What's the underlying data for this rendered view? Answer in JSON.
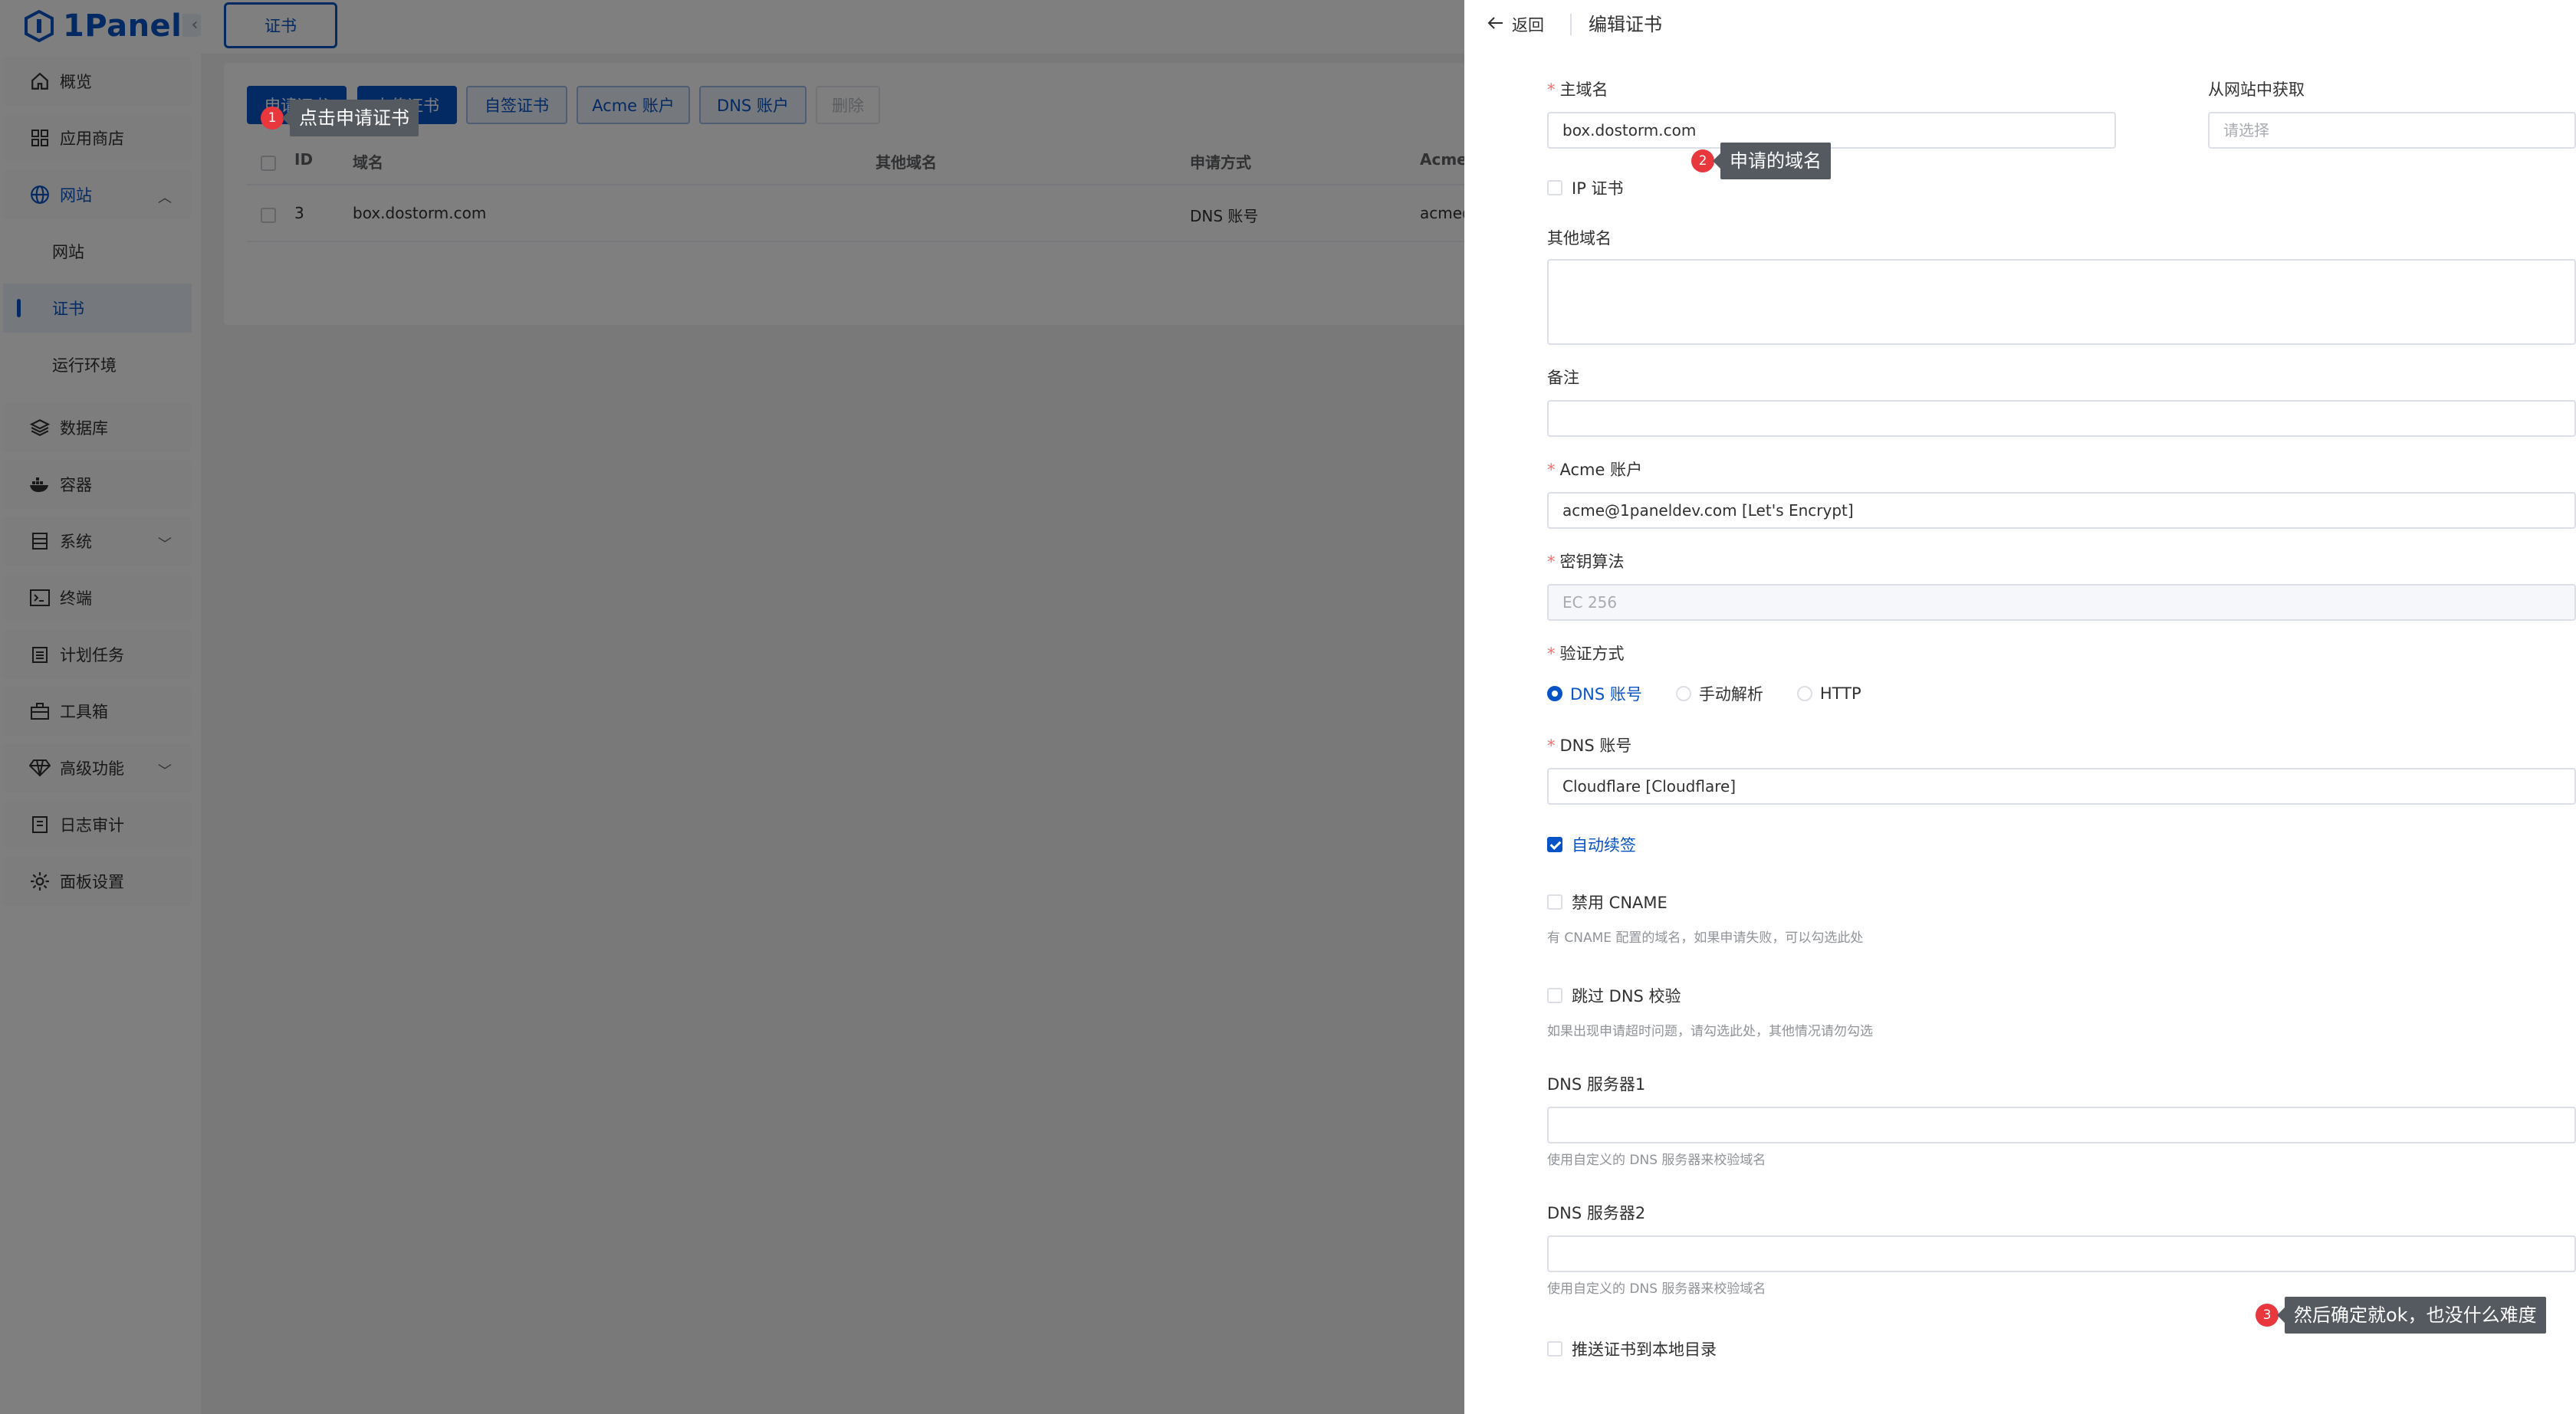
{
  "app": {
    "logo_text": "1Panel",
    "brand_color": "#0854c7"
  },
  "sidebar": {
    "items": [
      {
        "label": "概览",
        "icon": "home-icon"
      },
      {
        "label": "应用商店",
        "icon": "grid-icon"
      },
      {
        "label": "网站",
        "icon": "globe-icon",
        "expanded": true
      },
      {
        "label": "网站",
        "sub": true
      },
      {
        "label": "证书",
        "sub": true,
        "active": true
      },
      {
        "label": "运行环境",
        "sub": true
      },
      {
        "label": "数据库",
        "icon": "layers-icon"
      },
      {
        "label": "容器",
        "icon": "docker-icon"
      },
      {
        "label": "系统",
        "icon": "server-icon",
        "has_children": true
      },
      {
        "label": "终端",
        "icon": "terminal-icon"
      },
      {
        "label": "计划任务",
        "icon": "calendar-icon"
      },
      {
        "label": "工具箱",
        "icon": "toolbox-icon"
      },
      {
        "label": "高级功能",
        "icon": "diamond-icon",
        "has_children": true
      },
      {
        "label": "日志审计",
        "icon": "log-icon"
      },
      {
        "label": "面板设置",
        "icon": "gear-icon"
      }
    ]
  },
  "top_tabs": {
    "active": "证书"
  },
  "toolbar": {
    "apply_cert": "申请证书",
    "upload_cert": "上传证书",
    "self_signed": "自签证书",
    "acme_account": "Acme 账户",
    "dns_account": "DNS 账户",
    "delete": "删除"
  },
  "table": {
    "headers": [
      "ID",
      "域名",
      "其他域名",
      "申请方式",
      "Acme"
    ],
    "rows": [
      {
        "id": "3",
        "domain": "box.dostorm.com",
        "other": "",
        "method": "DNS 账号",
        "acme": "acme@"
      }
    ]
  },
  "drawer": {
    "back": "返回",
    "title": "编辑证书",
    "primary_domain": {
      "label": "主域名",
      "value": "box.dostorm.com"
    },
    "from_website": {
      "label": "从网站中获取",
      "placeholder": "请选择"
    },
    "ip_cert": {
      "label": "IP 证书",
      "checked": false
    },
    "other_domains": {
      "label": "其他域名",
      "value": ""
    },
    "remark": {
      "label": "备注",
      "value": ""
    },
    "acme_account": {
      "label": "Acme 账户",
      "value": "acme@1paneldev.com [Let's Encrypt]"
    },
    "key_algorithm": {
      "label": "密钥算法",
      "value": "EC 256"
    },
    "verify_method": {
      "label": "验证方式",
      "options": [
        "DNS 账号",
        "手动解析",
        "HTTP"
      ],
      "selected": "DNS 账号"
    },
    "dns_account": {
      "label": "DNS 账号",
      "value": "Cloudflare [Cloudflare]"
    },
    "auto_renew": {
      "label": "自动续签",
      "checked": true
    },
    "disable_cname": {
      "label": "禁用 CNAME",
      "checked": false,
      "hint": "有 CNAME 配置的域名，如果申请失败，可以勾选此处"
    },
    "skip_dns_check": {
      "label": "跳过 DNS 校验",
      "checked": false,
      "hint": "如果出现申请超时问题，请勾选此处，其他情况请勿勾选"
    },
    "dns_server1": {
      "label": "DNS 服务器1",
      "value": "",
      "hint": "使用自定义的 DNS 服务器来校验域名"
    },
    "dns_server2": {
      "label": "DNS 服务器2",
      "value": "",
      "hint": "使用自定义的 DNS 服务器来校验域名"
    },
    "push_local": {
      "label": "推送证书到本地目录",
      "checked": false
    }
  },
  "annotations": [
    {
      "num": "1",
      "text": "点击申请证书"
    },
    {
      "num": "2",
      "text": "申请的域名"
    },
    {
      "num": "3",
      "text": "然后确定就ok，也没什么难度"
    }
  ]
}
